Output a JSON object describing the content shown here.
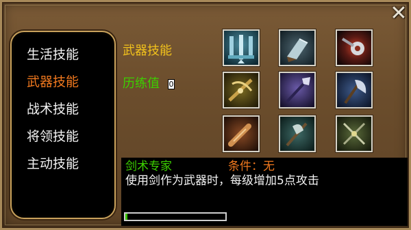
{
  "window": {
    "close_glyph": "✕"
  },
  "sidebar": {
    "items": [
      {
        "label": "生活技能",
        "active": false
      },
      {
        "label": "武器技能",
        "active": true
      },
      {
        "label": "战术技能",
        "active": false
      },
      {
        "label": "将领技能",
        "active": false
      },
      {
        "label": "主动技能",
        "active": false
      }
    ]
  },
  "content": {
    "section_title": "武器技能",
    "experience_label": "历练值",
    "experience_value": "0"
  },
  "skill_grid": [
    {
      "icon": "sword-pillar-icon",
      "selected": true
    },
    {
      "icon": "cleaver-icon",
      "selected": false
    },
    {
      "icon": "flaming-mace-icon",
      "selected": false
    },
    {
      "icon": "crossbow-icon",
      "selected": false
    },
    {
      "icon": "spear-icon",
      "selected": false
    },
    {
      "icon": "battle-axe-icon",
      "selected": false
    },
    {
      "icon": "war-club-icon",
      "selected": false
    },
    {
      "icon": "halberd-icon",
      "selected": false
    },
    {
      "icon": "crossed-blades-icon",
      "selected": false
    }
  ],
  "description": {
    "skill_name": "剑术专家",
    "condition": "条件：无",
    "text": "使用剑作为武器时，每级增加5点攻击",
    "progress": 0.01
  },
  "colors": {
    "active_tab": "#f0781e",
    "inactive_tab": "#f2f2f2",
    "gold_title": "#f2c21c",
    "green_text": "#3cd000",
    "frame_brown": "#6b4d2c",
    "sidebar_border": "#c9a25c"
  }
}
